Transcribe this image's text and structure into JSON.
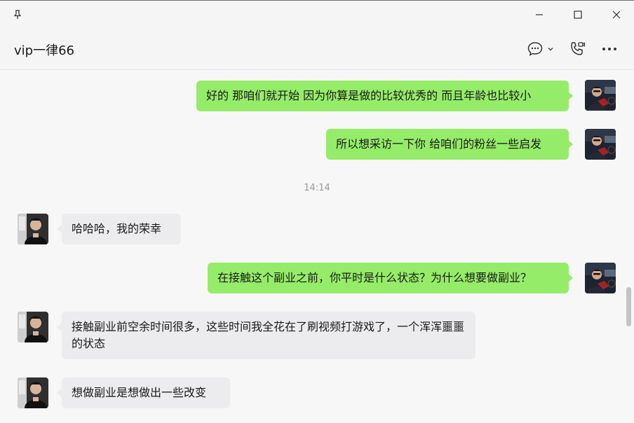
{
  "window": {
    "pin_icon": "pin-icon",
    "minimize_icon": "minimize-icon",
    "maximize_icon": "maximize-icon",
    "close_icon": "close-icon"
  },
  "header": {
    "title": "vip一律66",
    "icons": [
      "chat-bubble-icon",
      "chevron-down-icon",
      "phone-video-icon",
      "more-icon"
    ]
  },
  "messages": [
    {
      "side": "out",
      "text": "好的 那咱们就开始 因为你算是做的比较优秀的 而且年龄也比较小"
    },
    {
      "side": "out",
      "text": "所以想采访一下你 给咱们的粉丝一些启发"
    },
    {
      "side": "in",
      "text": "哈哈哈，我的荣幸"
    },
    {
      "side": "out",
      "text": "在接触这个副业之前，你平时是什么状态？为什么想要做副业？"
    },
    {
      "side": "in",
      "text": "接触副业前空余时间很多，这些时间我全花在了刷视频打游戏了，一个浑浑噩噩的状态"
    },
    {
      "side": "in",
      "text": "想做副业是想做出一些改变"
    }
  ],
  "timestamp": "14:14",
  "colors": {
    "outgoing_bubble": "#95ec69",
    "incoming_bubble": "#ececee",
    "background": "#f7f7f8"
  }
}
